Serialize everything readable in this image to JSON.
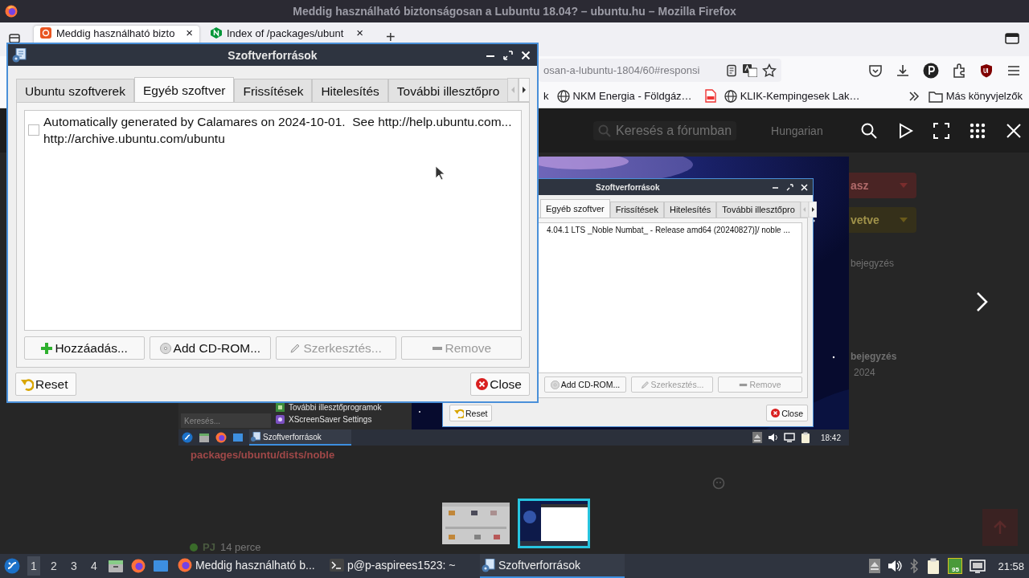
{
  "browser": {
    "title": "Meddig használható biztonságosan a Lubuntu 18.04? – ubuntu.hu – Mozilla Firefox",
    "tabs": [
      {
        "title": "Meddig használható bizto",
        "close": "×",
        "selected": true
      },
      {
        "title": "Index of /packages/ubunt",
        "close": "×",
        "selected": false
      }
    ],
    "new_tab": "+",
    "url": "osan-a-lubuntu-1804/60#responsi",
    "bookmarks": [
      {
        "kind": "text",
        "label": "k"
      },
      {
        "kind": "globe",
        "label": "NKM Energia - Földgáz…"
      },
      {
        "kind": "pdf"
      },
      {
        "kind": "globe",
        "label": "KLIK-Kempingesek Lak…"
      }
    ],
    "other_bookmarks": "Más könyvjelzők"
  },
  "page": {
    "search_placeholder": "Keresés a fórumban",
    "language": "Hungarian",
    "reply_button": "asz",
    "status_button": "vetve",
    "side_texts": [
      {
        "kind": "plain",
        "text": "bejegyzés"
      },
      {
        "kind": "bold",
        "text": "bejegyzés"
      },
      {
        "kind": "plain",
        "text": "2024"
      }
    ],
    "path": "packages/ubuntu/dists/noble",
    "author": "PJ",
    "time": "14 perce"
  },
  "lightbox": {
    "thumbnails": [
      {
        "selected": false
      },
      {
        "selected": true
      }
    ]
  },
  "screenshot": {
    "dialog": {
      "title": "Szoftverforrások",
      "tabs": [
        {
          "label": "Egyéb szoftver",
          "selected": true
        },
        {
          "label": "Frissítések",
          "selected": false
        },
        {
          "label": "Hitelesítés",
          "selected": false
        },
        {
          "label": "További illesztőpro",
          "selected": false
        }
      ],
      "line": "4.04.1 LTS _Noble Numbat_ - Release amd64 (20240827)]/ noble ...",
      "buttons": [
        {
          "kind": "cdrom",
          "label": "Add CD-ROM...",
          "disabled": false
        },
        {
          "kind": "edit",
          "label": "Szerkesztés...",
          "disabled": true
        },
        {
          "kind": "remove",
          "label": "Remove",
          "disabled": true
        }
      ],
      "reset": "Reset",
      "close": "Close"
    },
    "menu": {
      "search_placeholder": "Keresés...",
      "items": [
        {
          "kind": "driver",
          "label": "További illesztőprogramok"
        },
        {
          "kind": "screensaver",
          "label": "XScreenSaver Settings"
        }
      ]
    },
    "taskbar": {
      "task": "Szoftverforrások",
      "clock": "18:42"
    }
  },
  "dialog": {
    "title": "Szoftverforrások",
    "tabs": [
      {
        "label": "Ubuntu szoftverek",
        "selected": false
      },
      {
        "label": "Egyéb szoftver",
        "selected": true
      },
      {
        "label": "Frissítések",
        "selected": false
      },
      {
        "label": "Hitelesítés",
        "selected": false
      },
      {
        "label": "További illesztőpro",
        "selected": false
      }
    ],
    "sources": [
      {
        "checked": false,
        "comment": "Automatically generated by Calamares on 2024-10-01.  See http://help.ubuntu.com...",
        "uri": "http://archive.ubuntu.com/ubuntu"
      }
    ],
    "buttons": [
      {
        "kind": "add",
        "label": "Hozzáadás...",
        "disabled": false
      },
      {
        "kind": "cdrom",
        "label": "Add CD-ROM...",
        "disabled": false
      },
      {
        "kind": "edit",
        "label": "Szerkesztés...",
        "disabled": true
      },
      {
        "kind": "remove",
        "label": "Remove",
        "disabled": true
      }
    ],
    "reset": "Reset",
    "close": "Close"
  },
  "taskbar": {
    "workspaces": [
      {
        "label": "1",
        "selected": true
      },
      {
        "label": "2",
        "selected": false
      },
      {
        "label": "3",
        "selected": false
      },
      {
        "label": "4",
        "selected": false
      }
    ],
    "tasks": [
      {
        "kind": "firefox",
        "label": "Meddig használható b...",
        "selected": false
      },
      {
        "kind": "terminal",
        "label": "p@p-aspirees1523: ~",
        "selected": false
      },
      {
        "kind": "dialog",
        "label": "Szoftverforrások",
        "selected": true
      }
    ],
    "battery": "95",
    "clock": "21:58"
  }
}
